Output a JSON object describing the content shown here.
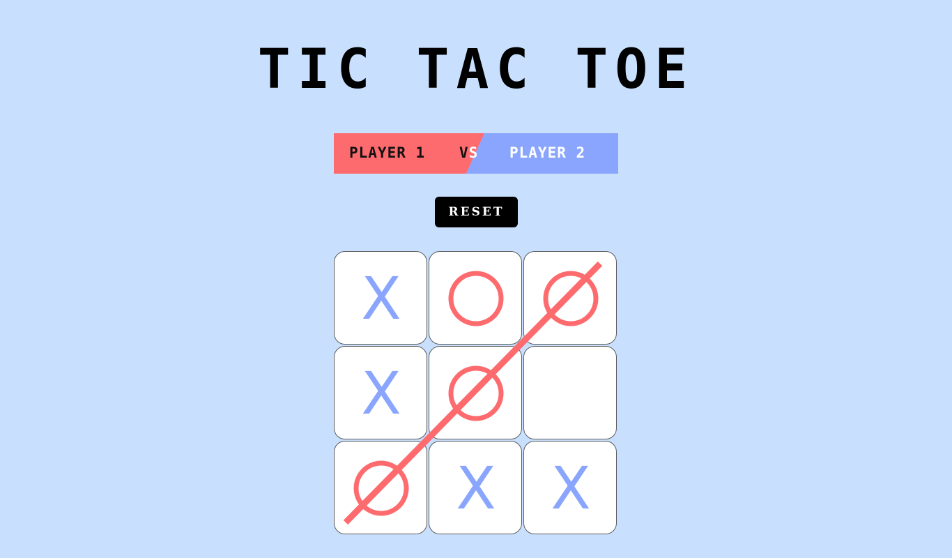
{
  "title": "TIC TAC TOE",
  "versus": {
    "player1": "PLAYER 1",
    "vs_v": "V",
    "vs_s": "S",
    "player2": "PLAYER 2",
    "player1_color": "#fe6b6e",
    "player2_color": "#8aa5fd"
  },
  "reset_label": "RESET",
  "board": [
    [
      "X",
      "O",
      "O"
    ],
    [
      "X",
      "O",
      ""
    ],
    [
      "O",
      "X",
      "X"
    ]
  ],
  "winning_line": "diagonal from bottom-left to top-right",
  "colors": {
    "background": "#c8e0fd",
    "x_mark": "#8aa5fd",
    "o_mark": "#fe6b6e",
    "win_line": "#fe6b6e"
  }
}
